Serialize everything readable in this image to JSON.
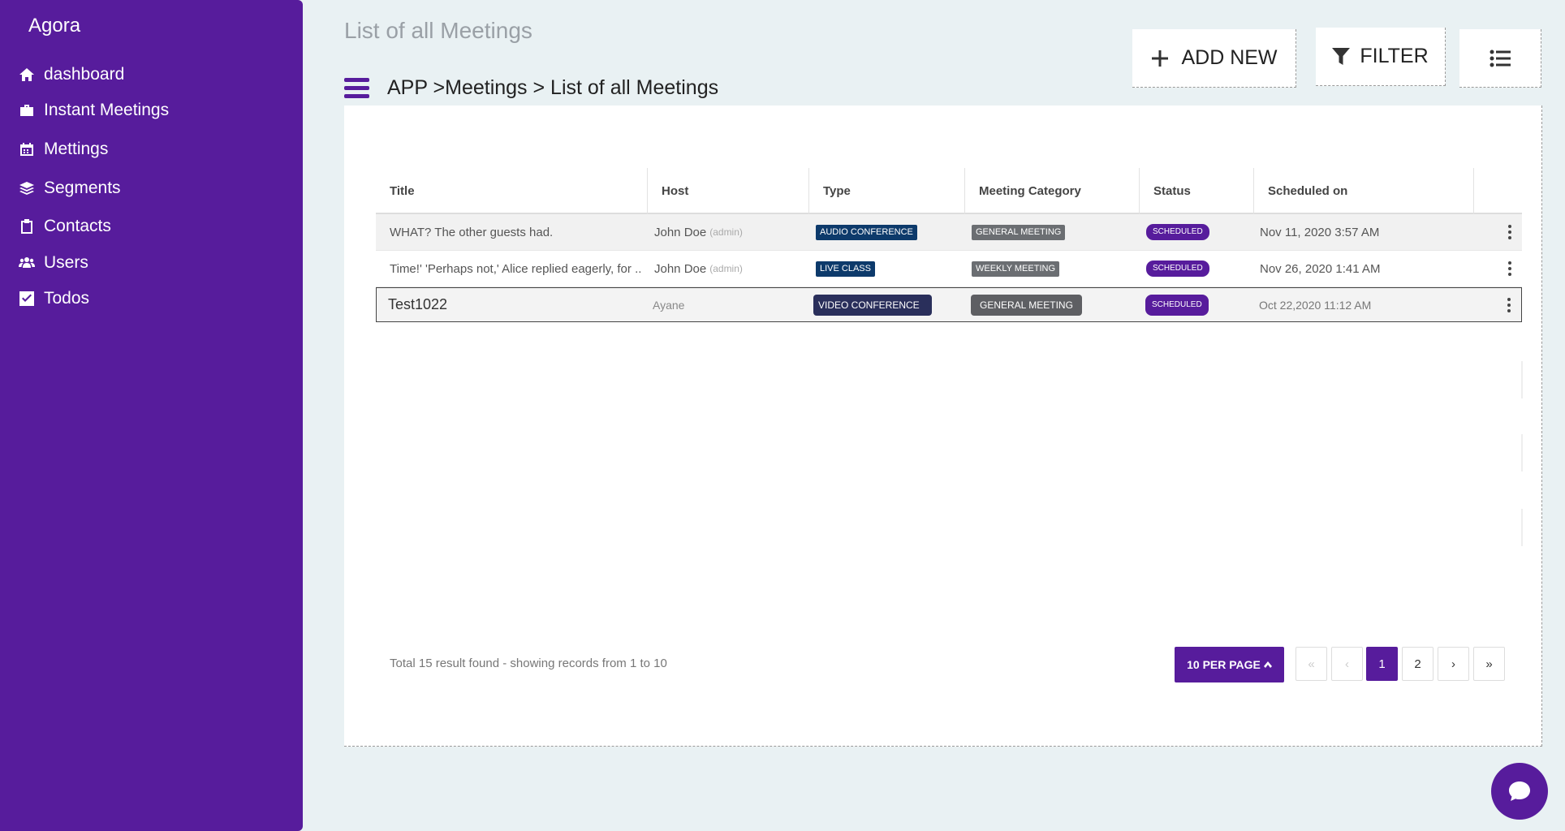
{
  "app": {
    "name": "Agora"
  },
  "sidebar": {
    "items": [
      {
        "label": "dashboard",
        "icon": "home-icon"
      },
      {
        "label": "Instant Meetings",
        "icon": "briefcase-icon"
      },
      {
        "label": "Mettings",
        "icon": "calendar-icon"
      },
      {
        "label": "Segments",
        "icon": "layers-icon"
      },
      {
        "label": "Contacts",
        "icon": "clipboard-icon"
      },
      {
        "label": "Users",
        "icon": "users-icon"
      },
      {
        "label": "Todos",
        "icon": "checkbox-icon"
      }
    ]
  },
  "header": {
    "title": "List of all Meetings",
    "breadcrumb": "APP >Meetings > List of all Meetings",
    "add_new_label": "ADD NEW",
    "filter_label": "FILTER"
  },
  "table": {
    "columns": [
      "Title",
      "Host",
      "Type",
      "Meeting Category",
      "Status",
      "Scheduled on"
    ],
    "rows": [
      {
        "title": "WHAT? The other guests had.",
        "host": "John Doe",
        "host_role": "(admin)",
        "type": "AUDIO CONFERENCE",
        "category": "GENERAL MEETING",
        "status": "SCHEDULED",
        "scheduled": "Nov 11, 2020 3:57 AM"
      },
      {
        "title": "Time!' 'Perhaps not,' Alice replied eagerly, for ...",
        "host": "John Doe",
        "host_role": "(admin)",
        "type": "LIVE CLASS",
        "category": "WEEKLY MEETING",
        "status": "SCHEDULED",
        "scheduled": "Nov 26, 2020 1:41 AM"
      },
      {
        "title": "Test1022",
        "host": "Ayane",
        "host_role": "",
        "type": "VIDEO CONFERENCE",
        "category": "GENERAL MEETING",
        "status": "SCHEDULED",
        "scheduled": "Oct 22,2020  11:12 AM"
      }
    ]
  },
  "footer": {
    "summary": "Total 15 result found - showing records from 1 to 10",
    "per_page_label": "10 PER PAGE",
    "pager": {
      "first": "«",
      "prev": "‹",
      "pages": [
        "1",
        "2"
      ],
      "next": "›",
      "last": "»",
      "current": "1"
    }
  },
  "colors": {
    "primary": "#571c9c",
    "type_badge": "#0d3a6b",
    "category_badge": "#6b6e72",
    "background": "#e9f1f3"
  }
}
